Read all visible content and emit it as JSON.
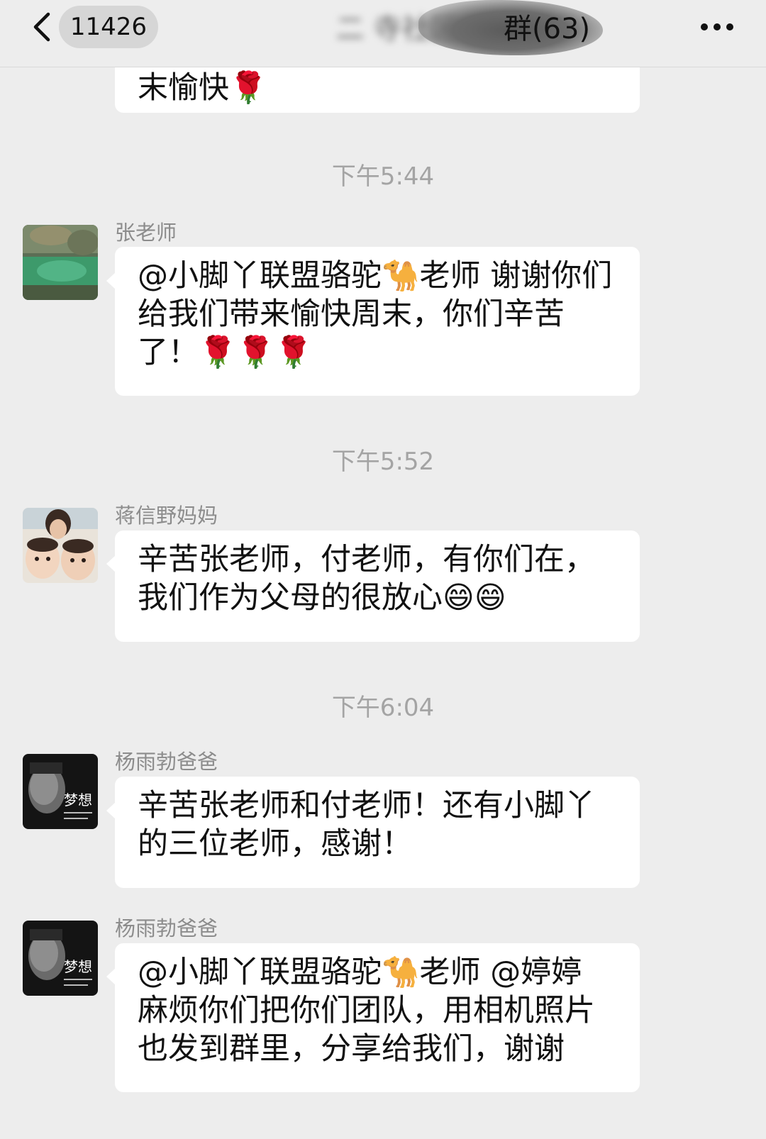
{
  "header": {
    "count_badge": "11426",
    "group_name": "二 寺社区 ",
    "member_count": "群(63)"
  },
  "messages": [
    {
      "text": "末愉快🌹"
    },
    {
      "timestamp": "下午5:44"
    },
    {
      "sender": "张老师",
      "text": "@小脚丫联盟骆驼🐪老师 谢谢你们给我们带来愉快周末，你们辛苦了！🌹🌹🌹"
    },
    {
      "timestamp": "下午5:52"
    },
    {
      "sender": "蒋信野妈妈",
      "text": "辛苦张老师，付老师，有你们在，我们作为父母的很放心😄😄"
    },
    {
      "timestamp": "下午6:04"
    },
    {
      "sender": "杨雨勃爸爸",
      "text": "辛苦张老师和付老师！还有小脚丫的三位老师，感谢！"
    },
    {
      "sender": "杨雨勃爸爸",
      "text": "@小脚丫联盟骆驼🐪老师 @婷婷 麻烦你们把你们团队，用相机照片也发到群里，分享给我们，谢谢"
    }
  ],
  "avatar_text": "梦想"
}
